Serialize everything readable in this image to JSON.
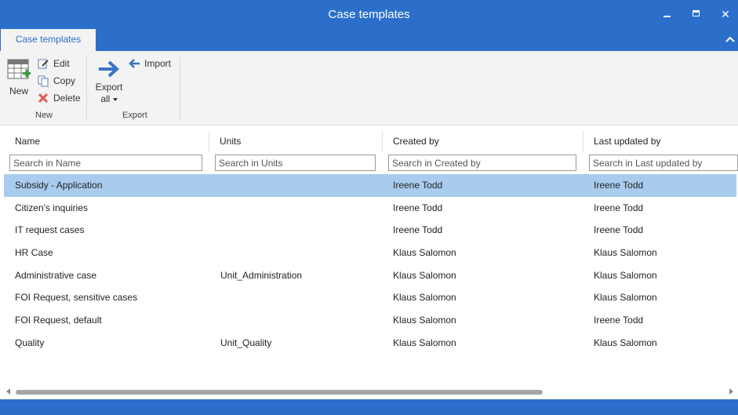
{
  "window": {
    "title": "Case templates",
    "minimize_icon": "minimize-icon",
    "maximize_icon": "maximize-icon",
    "close_glyph": "✕"
  },
  "colors": {
    "accent": "#2b6fcb",
    "ribbon_bg": "#f3f3f3",
    "selected_row": "#a9ccee"
  },
  "ribbon": {
    "tab_label": "Case templates",
    "groups": {
      "new": {
        "label": "New",
        "new_label": "New",
        "edit_label": "Edit",
        "copy_label": "Copy",
        "delete_label": "Delete"
      },
      "export": {
        "label": "Export",
        "export_line1": "Export",
        "export_line2": "all",
        "import_label": "Import"
      }
    }
  },
  "grid": {
    "columns": [
      {
        "header": "Name",
        "placeholder": "Search in Name"
      },
      {
        "header": "Units",
        "placeholder": "Search in Units"
      },
      {
        "header": "Created by",
        "placeholder": "Search in Created by"
      },
      {
        "header": "Last updated by",
        "placeholder": "Search in Last updated by"
      }
    ],
    "rows": [
      {
        "name": "Subsidy - Application",
        "units": "",
        "created_by": "Ireene Todd",
        "last_updated_by": "Ireene Todd",
        "selected": true
      },
      {
        "name": "Citizen's inquiries",
        "units": "",
        "created_by": "Ireene Todd",
        "last_updated_by": "Ireene Todd"
      },
      {
        "name": "IT request cases",
        "units": "",
        "created_by": "Ireene Todd",
        "last_updated_by": "Ireene Todd"
      },
      {
        "name": "HR Case",
        "units": "",
        "created_by": "Klaus Salomon",
        "last_updated_by": "Klaus Salomon"
      },
      {
        "name": "Administrative case",
        "units": "Unit_Administration",
        "created_by": "Klaus Salomon",
        "last_updated_by": "Klaus Salomon"
      },
      {
        "name": "FOI Request, sensitive cases",
        "units": "",
        "created_by": "Klaus Salomon",
        "last_updated_by": "Klaus Salomon"
      },
      {
        "name": "FOI Request, default",
        "units": "",
        "created_by": "Klaus Salomon",
        "last_updated_by": "Ireene Todd"
      },
      {
        "name": "Quality",
        "units": "Unit_Quality",
        "created_by": "Klaus Salomon",
        "last_updated_by": "Klaus Salomon"
      }
    ]
  }
}
